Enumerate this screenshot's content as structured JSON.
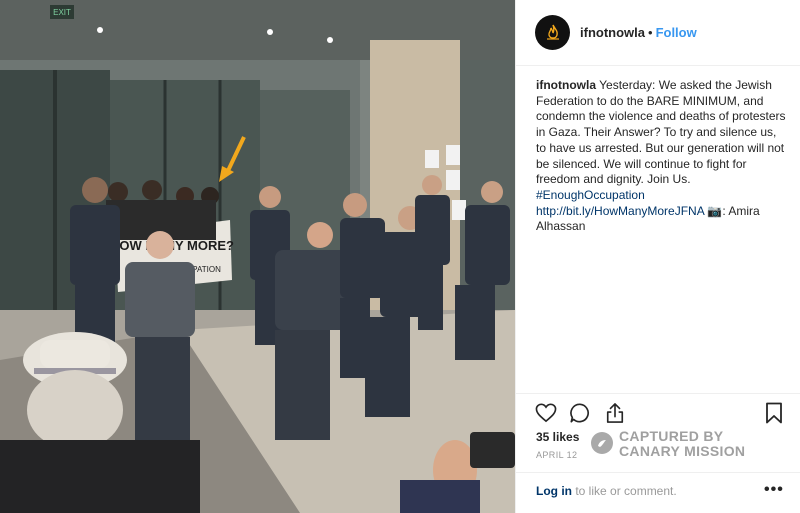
{
  "post": {
    "username": "ifnotnowla",
    "separator": "•",
    "follow_label": "Follow",
    "caption": {
      "username": "ifnotnowla",
      "text": "Yesterday: We asked the Jewish Federation to do the BARE MINIMUM, and condemn the violence and deaths of protesters in Gaza. Their Answer? To try and silence us, to have us arrested. But our generation will not be silenced. We will continue to fight for freedom and dignity. Join Us.",
      "hashtag": "#EnoughOccupation",
      "link": "http://bit.ly/HowManyMoreJFNA",
      "camera_emoji": "📷",
      "credit": ": Amira Alhassan"
    },
    "likes": "35 likes",
    "date": "APRIL 12"
  },
  "photo": {
    "door_sign": "EXIT",
    "banner_text_top": "HOW MANY MORE?",
    "banner_text_bottom": "#ENOUGHOCCUPATION"
  },
  "watermark": {
    "line1": "CAPTURED BY",
    "line2": "CANARY MISSION"
  },
  "footer": {
    "login_label": "Log in",
    "login_rest": " to like or comment.",
    "more_label": "•••"
  },
  "icons": {
    "like": "heart-icon",
    "comment": "comment-icon",
    "share": "share-icon",
    "save": "bookmark-icon",
    "avatar": "flame-logo-icon"
  },
  "colors": {
    "link_blue": "#3897f0",
    "dark_link": "#003569",
    "muted": "#999999",
    "arrow": "#f2a81d"
  }
}
